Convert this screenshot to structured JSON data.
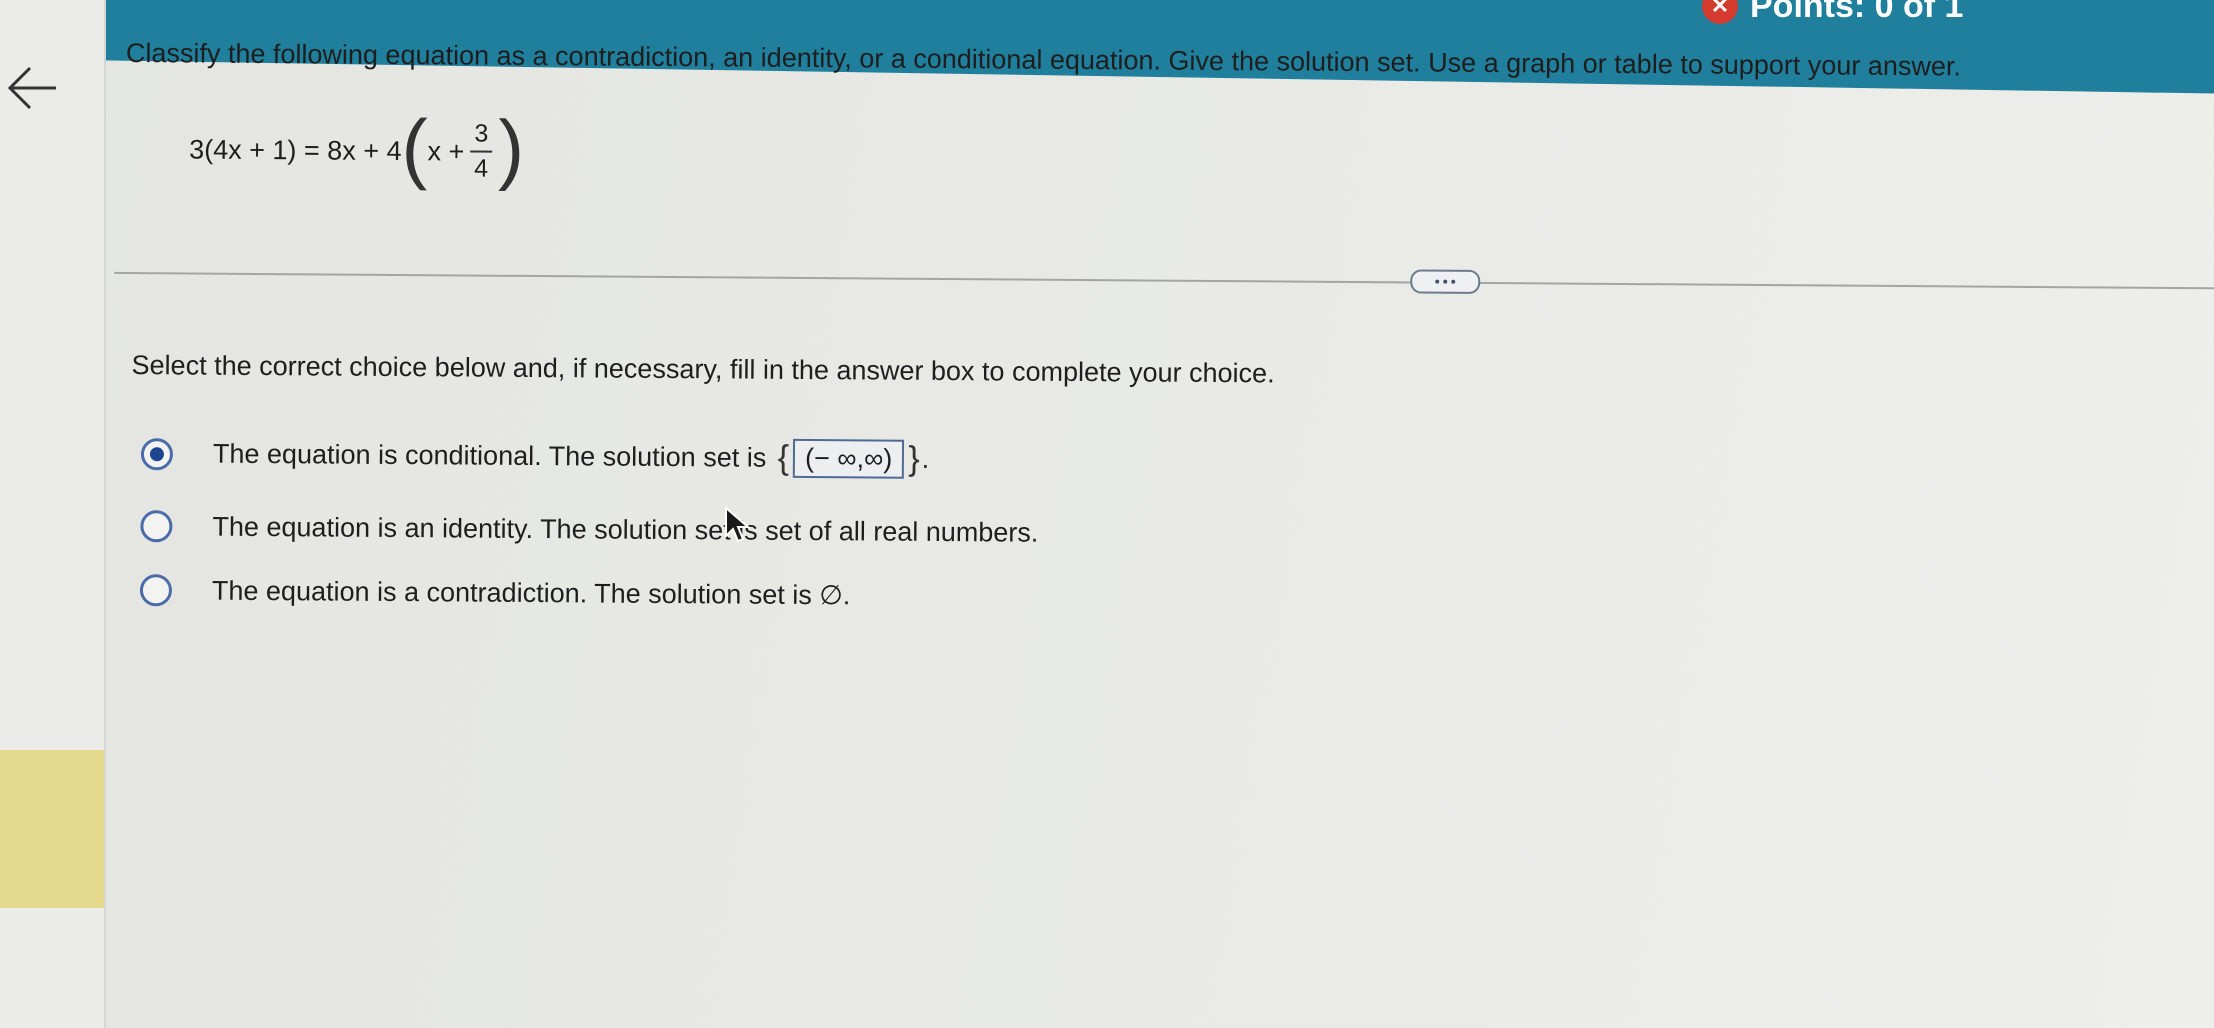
{
  "header": {
    "points_label": "Points: 0 of 1"
  },
  "question": {
    "text": "Classify the following equation as a contradiction, an identity, or a conditional equation. Give the solution set. Use a graph or table to support your answer.",
    "equation": {
      "left": "3(4x + 1) = 8x + 4",
      "inner": "x +",
      "frac_num": "3",
      "frac_den": "4"
    }
  },
  "instruction": "Select the correct choice below and, if necessary, fill in the answer box to complete your choice.",
  "choices": [
    {
      "text_before": "The equation is conditional. The solution set is",
      "answer_value": "(− ∞,∞)",
      "text_after": ".",
      "selected": true
    },
    {
      "text": "The equation is an identity. The solution set is set of all real numbers.",
      "selected": false
    },
    {
      "text": "The equation is a contradiction. The solution set is ∅.",
      "selected": false
    }
  ],
  "colors": {
    "header": "#1f7f9c",
    "radio_selected": "#1e4590",
    "radio_border": "#4a6ca8",
    "error_icon": "#d33b2f"
  },
  "icons": [
    "back-arrow-icon",
    "incorrect-x-icon",
    "more-dots-icon",
    "mouse-pointer-icon"
  ]
}
